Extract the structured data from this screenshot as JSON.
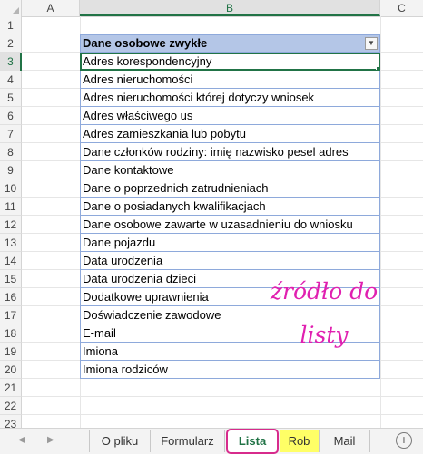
{
  "columns": [
    "A",
    "B",
    "C"
  ],
  "rows": [
    "1",
    "2",
    "3",
    "4",
    "5",
    "6",
    "7",
    "8",
    "9",
    "10",
    "11",
    "12",
    "13",
    "14",
    "15",
    "16",
    "17",
    "18",
    "19",
    "20",
    "21",
    "22",
    "23"
  ],
  "table": {
    "header": "Dane osobowe zwykłe",
    "filter_icon": "dropdown-arrow-icon",
    "items": [
      "Adres korespondencyjny",
      "Adres nieruchomości",
      "Adres nieruchomości której dotyczy wniosek",
      "Adres właściwego us",
      "Adres zamieszkania lub pobytu",
      "Dane członków rodziny: imię nazwisko pesel adres",
      "Dane kontaktowe",
      "Dane o poprzednich zatrudnieniach",
      "Dane o posiadanych kwalifikacjach",
      "Dane osobowe zawarte w uzasadnieniu do wniosku",
      "Dane pojazdu",
      "Data urodzenia",
      "Data urodzenia dzieci",
      "Dodatkowe uprawnienia",
      "Doświadczenie zawodowe",
      "E-mail",
      "Imiona",
      "Imiona rodziców"
    ]
  },
  "annotation": {
    "line1": "źródło do",
    "line2": "listy",
    "color": "#e020b0"
  },
  "sheets": {
    "tabs": [
      "O pliku",
      "Formularz",
      "Lista",
      "Rob",
      "Mail"
    ],
    "active": "Lista",
    "add_label": "+"
  },
  "colors": {
    "accent": "#217346",
    "table_header": "#b4c6e7",
    "highlight_border": "#d72b8c",
    "yellow_tab": "#ffff66"
  }
}
